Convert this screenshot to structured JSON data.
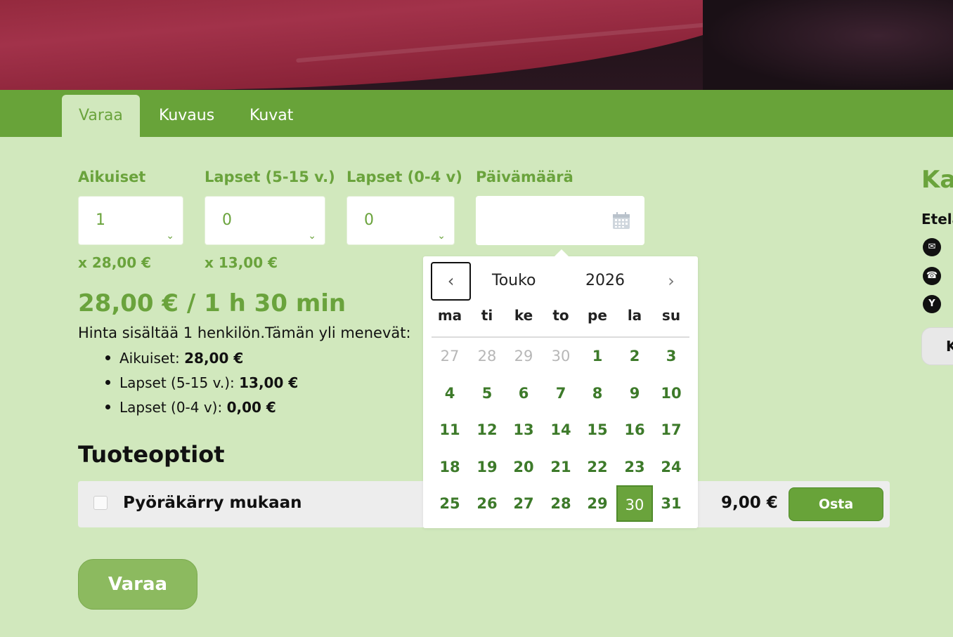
{
  "tabs": [
    {
      "label": "Varaa",
      "active": true
    },
    {
      "label": "Kuvaus",
      "active": false
    },
    {
      "label": "Kuvat",
      "active": false
    }
  ],
  "form": {
    "adults": {
      "label": "Aikuiset",
      "value": "1",
      "price": "x 28,00 €"
    },
    "children": {
      "label": "Lapset (5-15 v.)",
      "value": "0",
      "price": "x 13,00 €"
    },
    "toddlers": {
      "label": "Lapset (0-4 v)",
      "value": "0"
    },
    "date": {
      "label": "Päivämäärä",
      "value": ""
    }
  },
  "pricing": {
    "headline": "28,00 € / 1 h 30 min",
    "note": "Hinta sisältää 1 henkilön.Tämän yli menevät:",
    "items": [
      {
        "label": "Aikuiset: ",
        "price": "28,00 €"
      },
      {
        "label": "Lapset (5-15 v.): ",
        "price": "13,00 €"
      },
      {
        "label": "Lapset (0-4 v): ",
        "price": "0,00 €"
      }
    ]
  },
  "options": {
    "title": "Tuoteoptiot",
    "item": {
      "label": "Pyöräkärry mukaan",
      "price": "9,00 €",
      "button": "Osta",
      "checked": false
    }
  },
  "submit_label": "Varaa",
  "sidebar": {
    "title": "Kau",
    "subtitle": "Etelä",
    "icons": [
      "envelope-icon",
      "phone-icon",
      "y-icon"
    ],
    "y_glyph": "Y",
    "button": "K"
  },
  "calendar": {
    "month": "Touko",
    "year": "2026",
    "weekdays": [
      "ma",
      "ti",
      "ke",
      "to",
      "pe",
      "la",
      "su"
    ],
    "weeks": [
      [
        "27",
        "28",
        "29",
        "30",
        "1",
        "2",
        "3"
      ],
      [
        "4",
        "5",
        "6",
        "7",
        "8",
        "9",
        "10"
      ],
      [
        "11",
        "12",
        "13",
        "14",
        "15",
        "16",
        "17"
      ],
      [
        "18",
        "19",
        "20",
        "21",
        "22",
        "23",
        "24"
      ],
      [
        "25",
        "26",
        "27",
        "28",
        "29",
        "30",
        "31"
      ]
    ],
    "prev_month_days": 4,
    "selected_day": "30",
    "colors": {
      "accent": "#6aa33c",
      "day": "#3d7a2a",
      "muted": "#b7b7b7"
    }
  }
}
